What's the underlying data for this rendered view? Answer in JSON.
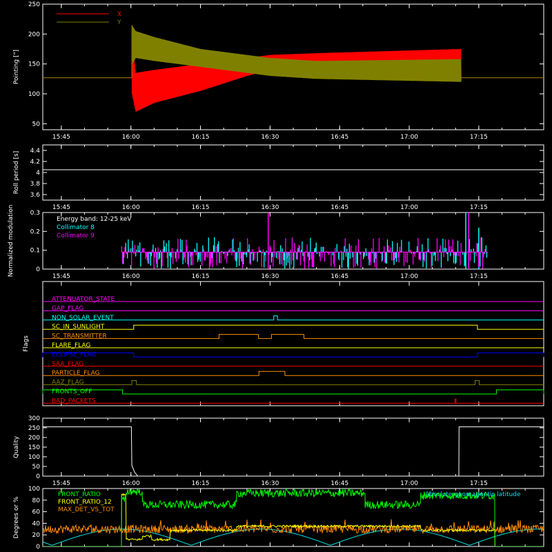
{
  "time_axis": {
    "ticks": [
      "15:45",
      "16:00",
      "16:15",
      "16:30",
      "16:45",
      "17:00",
      "17:15"
    ],
    "tick_minutes": [
      945,
      960,
      975,
      990,
      1005,
      1020,
      1035
    ],
    "range_minutes": [
      941,
      1049
    ]
  },
  "colors": {
    "background": "#000000",
    "axes": "#ffffff",
    "x": "#ff0000",
    "y": "#808000",
    "collimator8": "#00ffff",
    "collimator9": "#ff00ff",
    "front_ratio": "#00ff00",
    "front_ratio_12": "#ffff00",
    "max_det": "#ff8c00",
    "geomag": "#00e5e5"
  },
  "chart_data": [
    {
      "type": "line",
      "id": "pointing",
      "ylabel": "Pointing [\"]",
      "ylim": [
        40,
        250
      ],
      "yticks": [
        50,
        100,
        150,
        200,
        250
      ],
      "legend_position": "top-left",
      "series": [
        {
          "name": "X",
          "color": "#ff0000",
          "baseline": 127,
          "start": 960.2,
          "end": 1031.2,
          "envelope_x": [
            960.2,
            961,
            965,
            975,
            985,
            990,
            1000,
            1031.2
          ],
          "envelope_low": [
            100,
            70,
            85,
            105,
            130,
            140,
            145,
            145
          ],
          "envelope_high": [
            200,
            135,
            140,
            150,
            160,
            165,
            168,
            175
          ]
        },
        {
          "name": "Y",
          "color": "#808000",
          "baseline": 127,
          "start": 960.2,
          "end": 1031.2,
          "envelope_x": [
            960.2,
            961,
            965,
            975,
            985,
            990,
            1000,
            1031.2
          ],
          "envelope_low": [
            150,
            160,
            155,
            145,
            135,
            130,
            125,
            120
          ],
          "envelope_high": [
            215,
            205,
            195,
            175,
            165,
            160,
            155,
            158
          ]
        }
      ]
    },
    {
      "type": "line",
      "id": "roll",
      "ylabel": "Roll period [s]",
      "ylim": [
        3.5,
        4.5
      ],
      "yticks": [
        3.6,
        3.8,
        4.0,
        4.2,
        4.4
      ],
      "series": [
        {
          "name": "",
          "color": "#ffffff",
          "constant": 4.05
        }
      ]
    },
    {
      "type": "line",
      "id": "modulation",
      "ylabel": "Normalized modulation",
      "ylim": [
        0,
        0.3
      ],
      "yticks": [
        0.0,
        0.1,
        0.2,
        0.3
      ],
      "legend_title": "Energy band: 12-25 keV",
      "legend_position": "top-left",
      "start": 958,
      "end": 1037,
      "baseline": 0.09,
      "series": [
        {
          "name": "Collimator 8",
          "color": "#00ffff"
        },
        {
          "name": "Collimator 9",
          "color": "#ff00ff"
        }
      ],
      "spikes": [
        {
          "t": 989.6,
          "v": 0.3,
          "series": 1
        },
        {
          "t": 1032.2,
          "v": 0.3,
          "series": 0
        },
        {
          "t": 1032.8,
          "v": 0.3,
          "series": 1
        },
        {
          "t": 1035.0,
          "v": 0.22,
          "series": 0
        }
      ]
    },
    {
      "type": "line",
      "id": "flags",
      "ylabel": "Flags",
      "series": [
        {
          "name": "ATTENUATOR_STATE",
          "color": "#ff00ff",
          "high": []
        },
        {
          "name": "GAP_FLAG",
          "color": "#ff00ff",
          "high": []
        },
        {
          "name": "NON_SOLAR_EVENT",
          "color": "#00ffff",
          "high": [
            [
              990.8,
              991.6
            ]
          ]
        },
        {
          "name": "SC_IN_SUNLIGHT",
          "color": "#ffff00",
          "high": [
            [
              960.6,
              1034.7
            ]
          ]
        },
        {
          "name": "SC_TRANSMITTER",
          "color": "#ff8c00",
          "high": [
            [
              979.0,
              987.5
            ],
            [
              990.3,
              997.3
            ]
          ]
        },
        {
          "name": "FLARE_FLAG",
          "color": "#ffff00",
          "high": []
        },
        {
          "name": "ECLIPSE_FLAG",
          "color": "#0000ff",
          "high": [
            [
              941,
              960.6
            ],
            [
              1034.7,
              1049
            ]
          ]
        },
        {
          "name": "SAA_FLAG",
          "color": "#ff0000",
          "high": []
        },
        {
          "name": "PARTICLE_FLAG",
          "color": "#ff8c00",
          "high": [
            [
              987.6,
              993.2
            ]
          ]
        },
        {
          "name": "AAZ_FLAG",
          "color": "#808000",
          "high": [
            [
              960.2,
              961.2
            ],
            [
              1034.2,
              1035.1
            ]
          ]
        },
        {
          "name": "FRONTS_OFF",
          "color": "#00ff00",
          "high": [
            [
              941,
              958.2
            ],
            [
              1038.8,
              1049
            ]
          ]
        },
        {
          "name": "BAD_PACKETS",
          "color": "#ff0000",
          "high": [
            [
              1029.9,
              1030.1
            ]
          ]
        }
      ]
    },
    {
      "type": "line",
      "id": "quality",
      "ylabel": "Quality",
      "ylim": [
        0,
        300
      ],
      "yticks": [
        0,
        50,
        100,
        150,
        200,
        250,
        300
      ],
      "series": [
        {
          "name": "",
          "color": "#ffffff",
          "x": [
            941,
            960.1,
            960.2,
            960.8,
            961.3,
            961.5,
            1030.7,
            1030.75,
            1049
          ],
          "y": [
            255,
            255,
            55,
            20,
            5,
            0,
            0,
            255,
            255
          ]
        }
      ]
    },
    {
      "type": "line",
      "id": "ratios",
      "ylabel": "Degrees or %",
      "ylim": [
        0,
        100
      ],
      "yticks": [
        0,
        20,
        40,
        60,
        80,
        100
      ],
      "legend_position": "top-left",
      "series": [
        {
          "name": "FRONT_RATIO",
          "color": "#00ff00",
          "steps": [
            [
              941,
              958,
              0
            ],
            [
              958,
              959,
              80
            ],
            [
              959,
              962.5,
              95
            ],
            [
              962.5,
              982.8,
              72
            ],
            [
              982.8,
              1010.5,
              92
            ],
            [
              1010.5,
              1022.5,
              72
            ],
            [
              1022.5,
              1038.5,
              88
            ],
            [
              1038.5,
              1049,
              0
            ]
          ]
        },
        {
          "name": "FRONT_RATIO_12",
          "color": "#ffff00",
          "steps": [
            [
              941,
              958,
              0
            ],
            [
              958,
              959,
              90
            ],
            [
              959,
              962.5,
              12
            ],
            [
              962.5,
              964.5,
              18
            ],
            [
              964.5,
              968.5,
              12
            ],
            [
              968.5,
              982.8,
              28
            ],
            [
              982.8,
              1022.5,
              35
            ],
            [
              1022.5,
              1038.5,
              28
            ],
            [
              1038.5,
              1049,
              0
            ]
          ]
        },
        {
          "name": "MAX_DET_VS_TOT",
          "color": "#ff8c00",
          "level": 30,
          "noise": 7
        },
        {
          "name": "Absolute geomagnetic latitude",
          "color": "#00e5e5"
        }
      ]
    }
  ]
}
